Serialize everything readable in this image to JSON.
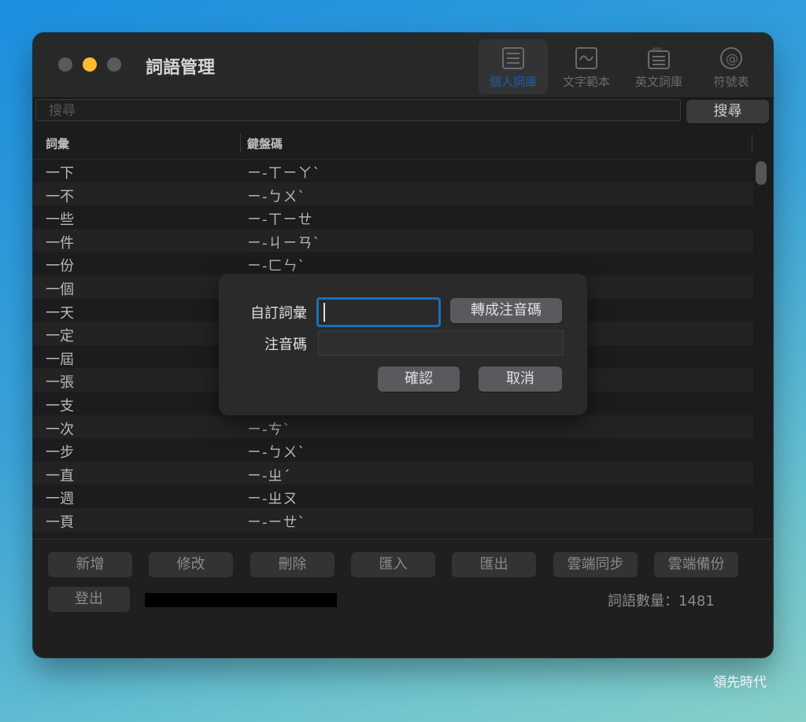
{
  "window": {
    "title": "詞語管理",
    "toolbar": [
      {
        "label": "個人詞庫",
        "icon": "list-icon",
        "active": true
      },
      {
        "label": "文字範本",
        "icon": "text-template-icon",
        "active": false
      },
      {
        "label": "英文詞庫",
        "icon": "abc-list-icon",
        "active": false
      },
      {
        "label": "符號表",
        "icon": "at-symbol-icon",
        "active": false
      }
    ]
  },
  "search": {
    "placeholder": "搜尋",
    "button_label": "搜尋"
  },
  "table": {
    "headers": [
      "詞彙",
      "鍵盤碼"
    ],
    "rows": [
      {
        "word": "一下",
        "code": "ㄧ-ㄒㄧㄚˋ"
      },
      {
        "word": "一不",
        "code": "ㄧ-ㄅㄨˋ"
      },
      {
        "word": "一些",
        "code": "ㄧ-ㄒㄧㄝ"
      },
      {
        "word": "一件",
        "code": "ㄧ-ㄐㄧㄢˋ"
      },
      {
        "word": "一份",
        "code": "ㄧ-ㄈㄣˋ"
      },
      {
        "word": "一個",
        "code": ""
      },
      {
        "word": "一天",
        "code": ""
      },
      {
        "word": "一定",
        "code": ""
      },
      {
        "word": "一屆",
        "code": ""
      },
      {
        "word": "一張",
        "code": ""
      },
      {
        "word": "一支",
        "code": ""
      },
      {
        "word": "一次",
        "code": "ㄧ-ㄘˋ"
      },
      {
        "word": "一步",
        "code": "ㄧ-ㄅㄨˋ"
      },
      {
        "word": "一直",
        "code": "ㄧ-ㄓˊ"
      },
      {
        "word": "一週",
        "code": "ㄧ-ㄓㄡ"
      },
      {
        "word": "一頁",
        "code": "ㄧ-ㄧㄝˋ"
      }
    ]
  },
  "bottom": {
    "buttons": [
      "新增",
      "修改",
      "刪除",
      "匯入",
      "匯出",
      "雲端同步",
      "雲端備份"
    ],
    "logout_label": "登出",
    "count_text": "詞語數量：1481"
  },
  "dialog": {
    "custom_word_label": "自訂詞彙",
    "custom_word_value": "",
    "convert_button": "轉成注音碼",
    "zhuyin_label": "注音碼",
    "zhuyin_value": "",
    "confirm_button": "確認",
    "cancel_button": "取消"
  },
  "watermark": "領先時代",
  "colors": {
    "accent": "#1c6fb8",
    "yellow_light": "#febc2e"
  }
}
